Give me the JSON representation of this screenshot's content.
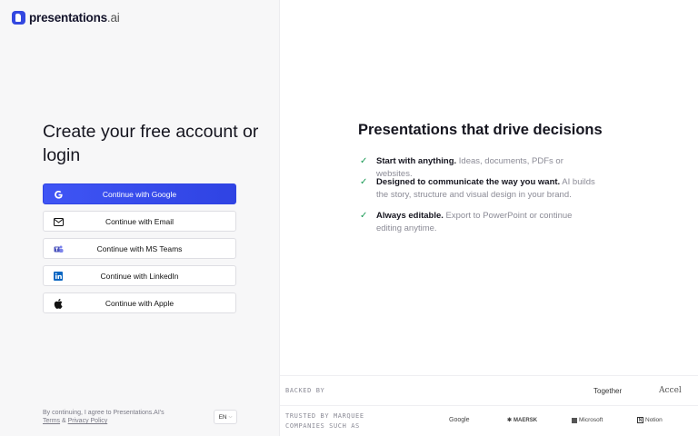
{
  "logo": {
    "name": "presentations",
    "suffix": ".ai"
  },
  "auth": {
    "heading": "Create your free account or login",
    "buttons": [
      {
        "label": "Continue with Google",
        "icon": "google-icon"
      },
      {
        "label": "Continue with Email",
        "icon": "mail-icon"
      },
      {
        "label": "Continue with MS Teams",
        "icon": "ms-teams-icon"
      },
      {
        "label": "Continue with LinkedIn",
        "icon": "linkedin-icon"
      },
      {
        "label": "Continue with Apple",
        "icon": "apple-icon"
      }
    ],
    "legal": {
      "text": "By continuing, I agree to Presentations.AI's",
      "terms": "Terms",
      "amp": " & ",
      "privacy": "Privacy Policy"
    },
    "language": "EN"
  },
  "marketing": {
    "title": "Presentations that drive decisions",
    "features": [
      {
        "bold": "Start with anything.",
        "muted": " Ideas, documents, PDFs or websites."
      },
      {
        "bold": "Designed to communicate the way you want.",
        "muted": " AI builds the story, structure and visual design in your brand."
      },
      {
        "bold": "Always editable.",
        "muted": " Export to PowerPoint or continue editing anytime."
      }
    ],
    "backed_by": {
      "label": "BACKED BY",
      "investors": [
        "Together",
        "Accel"
      ]
    },
    "trusted": {
      "label_line1": "TRUSTED BY MARQUEE",
      "label_line2": "COMPANIES SUCH AS",
      "companies": [
        "Google",
        "MAERSK",
        "Microsoft",
        "Notion"
      ]
    }
  },
  "colors": {
    "accent": "#3348e0",
    "check": "#1a9a55"
  }
}
